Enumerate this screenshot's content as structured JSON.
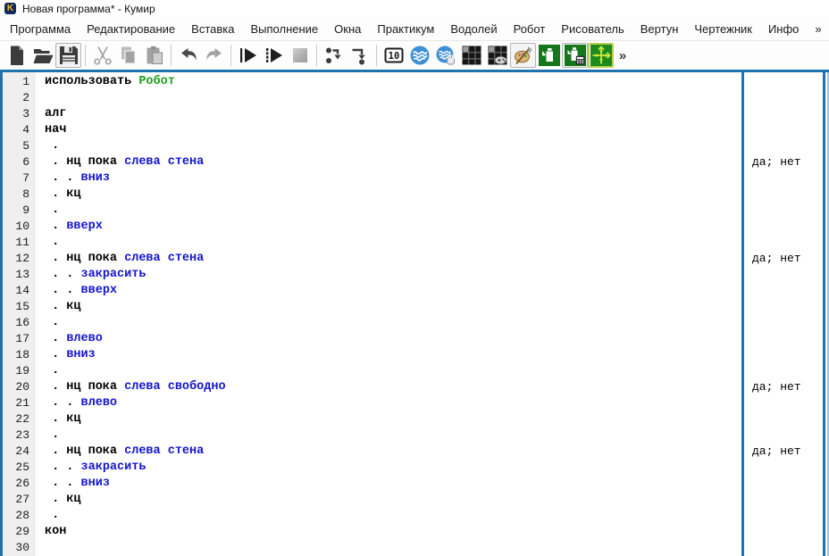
{
  "window": {
    "title": "Новая программа* - Кумир",
    "app_icon_letter": "K"
  },
  "menu": {
    "items": [
      {
        "id": "programma",
        "label": "Программа"
      },
      {
        "id": "redaktirovanie",
        "label": "Редактирование"
      },
      {
        "id": "vstavka",
        "label": "Вставка"
      },
      {
        "id": "vypolnenie",
        "label": "Выполнение"
      },
      {
        "id": "okna",
        "label": "Окна"
      },
      {
        "id": "praktikum",
        "label": "Практикум"
      },
      {
        "id": "vodoley",
        "label": "Водолей"
      },
      {
        "id": "robot",
        "label": "Робот"
      },
      {
        "id": "risovatel",
        "label": "Рисователь"
      },
      {
        "id": "vertun",
        "label": "Вертун"
      },
      {
        "id": "chertezhnik",
        "label": "Чертежник"
      },
      {
        "id": "info",
        "label": "Инфо"
      },
      {
        "id": "more",
        "label": "»"
      }
    ]
  },
  "toolbar": {
    "items": [
      {
        "id": "new-file",
        "icon": "new",
        "disabled": false,
        "frame": "none",
        "sep_after": false
      },
      {
        "id": "open-file",
        "icon": "open",
        "disabled": false,
        "frame": "none",
        "sep_after": false
      },
      {
        "id": "save-file",
        "icon": "save",
        "disabled": false,
        "frame": "gray",
        "sep_after": true
      },
      {
        "id": "cut",
        "icon": "cut",
        "disabled": true,
        "frame": "none",
        "sep_after": false
      },
      {
        "id": "copy",
        "icon": "copy",
        "disabled": true,
        "frame": "none",
        "sep_after": false
      },
      {
        "id": "paste",
        "icon": "paste",
        "disabled": true,
        "frame": "none",
        "sep_after": true
      },
      {
        "id": "undo",
        "icon": "undo",
        "disabled": false,
        "frame": "none",
        "sep_after": false
      },
      {
        "id": "redo",
        "icon": "redo",
        "disabled": true,
        "frame": "none",
        "sep_after": true
      },
      {
        "id": "run",
        "icon": "run",
        "disabled": false,
        "frame": "none",
        "sep_after": false
      },
      {
        "id": "run-steps",
        "icon": "runsteps",
        "disabled": false,
        "frame": "none",
        "sep_after": false
      },
      {
        "id": "stop",
        "icon": "stop",
        "disabled": true,
        "frame": "none",
        "sep_after": true
      },
      {
        "id": "step-over",
        "icon": "stepover",
        "disabled": false,
        "frame": "none",
        "sep_after": false
      },
      {
        "id": "step-into",
        "icon": "stepinto",
        "disabled": false,
        "frame": "none",
        "sep_after": true
      },
      {
        "id": "counter-display",
        "icon": "counter10",
        "disabled": false,
        "frame": "none",
        "sep_after": false
      },
      {
        "id": "vodoley",
        "icon": "vodoley",
        "disabled": false,
        "frame": "none",
        "sep_after": false
      },
      {
        "id": "vodoley-control",
        "icon": "vodoleyhand",
        "disabled": false,
        "frame": "none",
        "sep_after": false
      },
      {
        "id": "robot-field",
        "icon": "robotfield",
        "disabled": false,
        "frame": "none",
        "sep_after": false
      },
      {
        "id": "robot-control",
        "icon": "robotremote",
        "disabled": false,
        "frame": "none",
        "sep_after": false
      },
      {
        "id": "risovatel",
        "icon": "painter",
        "disabled": false,
        "frame": "gray",
        "sep_after": false
      },
      {
        "id": "vertun",
        "icon": "vertun",
        "disabled": false,
        "frame": "none",
        "sep_after": false
      },
      {
        "id": "vertun-control",
        "icon": "vertuncalc",
        "disabled": false,
        "frame": "gray",
        "sep_after": false
      },
      {
        "id": "chertezhnik",
        "icon": "axes",
        "disabled": false,
        "frame": "yellow",
        "sep_after": false
      },
      {
        "id": "toolbar-more",
        "icon": "more",
        "disabled": false,
        "frame": "none",
        "sep_after": false
      }
    ]
  },
  "editor": {
    "margin_marker": "да; нет",
    "lines": [
      {
        "num": "1",
        "tokens": [
          [
            "kw",
            "использовать "
          ],
          [
            "act",
            "Робот"
          ]
        ],
        "margin": ""
      },
      {
        "num": "2",
        "tokens": [],
        "margin": ""
      },
      {
        "num": "3",
        "tokens": [
          [
            "kw",
            "алг"
          ]
        ],
        "margin": ""
      },
      {
        "num": "4",
        "tokens": [
          [
            "kw",
            "нач"
          ]
        ],
        "margin": ""
      },
      {
        "num": "5",
        "tokens": [
          [
            "kw",
            " ."
          ]
        ],
        "margin": ""
      },
      {
        "num": "6",
        "tokens": [
          [
            "kw",
            " . нц пока "
          ],
          [
            "cmd",
            "слева стена"
          ]
        ],
        "margin": "да; нет"
      },
      {
        "num": "7",
        "tokens": [
          [
            "kw",
            " . . "
          ],
          [
            "cmd",
            "вниз"
          ]
        ],
        "margin": ""
      },
      {
        "num": "8",
        "tokens": [
          [
            "kw",
            " . кц"
          ]
        ],
        "margin": ""
      },
      {
        "num": "9",
        "tokens": [
          [
            "kw",
            " ."
          ]
        ],
        "margin": ""
      },
      {
        "num": "10",
        "tokens": [
          [
            "kw",
            " . "
          ],
          [
            "cmd",
            "вверх"
          ]
        ],
        "margin": ""
      },
      {
        "num": "11",
        "tokens": [
          [
            "kw",
            " ."
          ]
        ],
        "margin": ""
      },
      {
        "num": "12",
        "tokens": [
          [
            "kw",
            " . нц пока "
          ],
          [
            "cmd",
            "слева стена"
          ]
        ],
        "margin": "да; нет"
      },
      {
        "num": "13",
        "tokens": [
          [
            "kw",
            " . . "
          ],
          [
            "cmd",
            "закрасить"
          ]
        ],
        "margin": ""
      },
      {
        "num": "14",
        "tokens": [
          [
            "kw",
            " . . "
          ],
          [
            "cmd",
            "вверх"
          ]
        ],
        "margin": ""
      },
      {
        "num": "15",
        "tokens": [
          [
            "kw",
            " . кц"
          ]
        ],
        "margin": ""
      },
      {
        "num": "16",
        "tokens": [
          [
            "kw",
            " ."
          ]
        ],
        "margin": ""
      },
      {
        "num": "17",
        "tokens": [
          [
            "kw",
            " . "
          ],
          [
            "cmd",
            "влево"
          ]
        ],
        "margin": ""
      },
      {
        "num": "18",
        "tokens": [
          [
            "kw",
            " . "
          ],
          [
            "cmd",
            "вниз"
          ]
        ],
        "margin": ""
      },
      {
        "num": "19",
        "tokens": [
          [
            "kw",
            " ."
          ]
        ],
        "margin": ""
      },
      {
        "num": "20",
        "tokens": [
          [
            "kw",
            " . нц пока "
          ],
          [
            "cmd",
            "слева свободно"
          ]
        ],
        "margin": "да; нет"
      },
      {
        "num": "21",
        "tokens": [
          [
            "kw",
            " . . "
          ],
          [
            "cmd",
            "влево"
          ]
        ],
        "margin": ""
      },
      {
        "num": "22",
        "tokens": [
          [
            "kw",
            " . кц"
          ]
        ],
        "margin": ""
      },
      {
        "num": "23",
        "tokens": [
          [
            "kw",
            " ."
          ]
        ],
        "margin": ""
      },
      {
        "num": "24",
        "tokens": [
          [
            "kw",
            " . нц пока "
          ],
          [
            "cmd",
            "слева стена"
          ]
        ],
        "margin": "да; нет"
      },
      {
        "num": "25",
        "tokens": [
          [
            "kw",
            " . . "
          ],
          [
            "cmd",
            "закрасить"
          ]
        ],
        "margin": ""
      },
      {
        "num": "26",
        "tokens": [
          [
            "kw",
            " . . "
          ],
          [
            "cmd",
            "вниз"
          ]
        ],
        "margin": ""
      },
      {
        "num": "27",
        "tokens": [
          [
            "kw",
            " . кц"
          ]
        ],
        "margin": ""
      },
      {
        "num": "28",
        "tokens": [
          [
            "kw",
            " ."
          ]
        ],
        "margin": ""
      },
      {
        "num": "29",
        "tokens": [
          [
            "kw",
            "кон"
          ]
        ],
        "margin": ""
      },
      {
        "num": "30",
        "tokens": [],
        "margin": ""
      }
    ]
  },
  "colors": {
    "accent_blue": "#1e72b0",
    "keyword": "#000000",
    "command_blue": "#1414cd",
    "actor_green": "#1ea11e",
    "gutter_bg": "#efefef"
  }
}
